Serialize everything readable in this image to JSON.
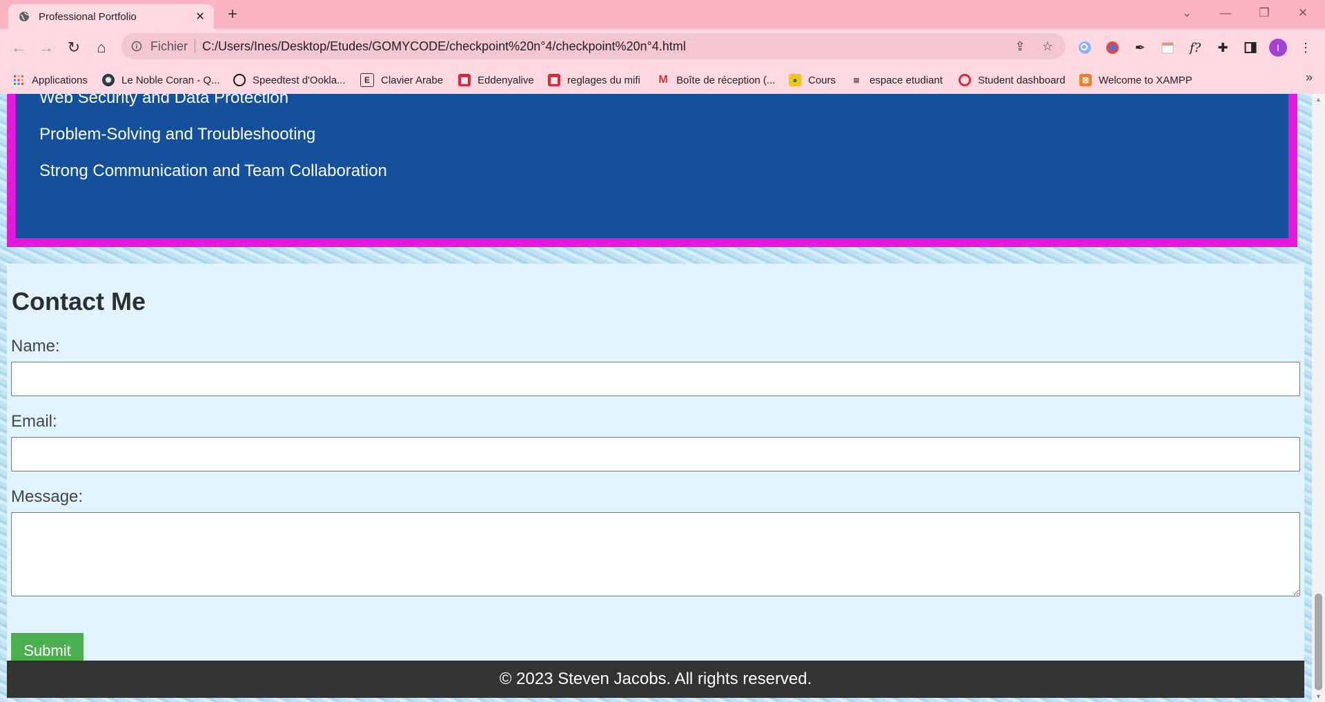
{
  "browser": {
    "tab_title": "Professional Portfolio",
    "tab_close": "✕",
    "new_tab": "+",
    "scheme_label": "Fichier",
    "url": "C:/Users/Ines/Desktop/Etudes/GOMYCODE/checkpoint%20n°4/checkpoint%20n°4.html",
    "profile_initial": "I",
    "bookmarks": [
      {
        "label": "Applications",
        "icon": "apps-grid-icon"
      },
      {
        "label": "Le Noble Coran - Q...",
        "icon": "coran-icon"
      },
      {
        "label": "Speedtest d'Ookla...",
        "icon": "speedtest-icon"
      },
      {
        "label": "Clavier Arabe",
        "icon": "clavier-icon"
      },
      {
        "label": "Eddenyalive",
        "icon": "eddenya-icon"
      },
      {
        "label": "reglages du mifi",
        "icon": "mifi-icon"
      },
      {
        "label": "Boîte de réception (...",
        "icon": "gmail-icon"
      },
      {
        "label": "Cours",
        "icon": "classroom-icon"
      },
      {
        "label": "espace etudiant",
        "icon": "student-space-icon"
      },
      {
        "label": "Student dashboard",
        "icon": "dashboard-icon"
      },
      {
        "label": "Welcome to XAMPP",
        "icon": "xampp-icon"
      }
    ],
    "bookmarks_more": "»"
  },
  "skills": {
    "items": [
      "Web Security and Data Protection",
      "Problem-Solving and Troubleshooting",
      "Strong Communication and Team Collaboration"
    ]
  },
  "contact": {
    "heading": "Contact Me",
    "name_label": "Name:",
    "name_value": "",
    "email_label": "Email:",
    "email_value": "",
    "message_label": "Message:",
    "message_value": "",
    "submit_label": "Submit"
  },
  "footer": {
    "text": "© 2023 Steven Jacobs. All rights reserved."
  },
  "colors": {
    "tabstrip": "#fbb4c2",
    "toolbar": "#ffd9e1",
    "skills_bg": "#15509a",
    "skills_border": "#e419de",
    "contact_bg": "#e1f4fd",
    "submit_bg": "#4caf50",
    "footer_bg": "#333333"
  }
}
